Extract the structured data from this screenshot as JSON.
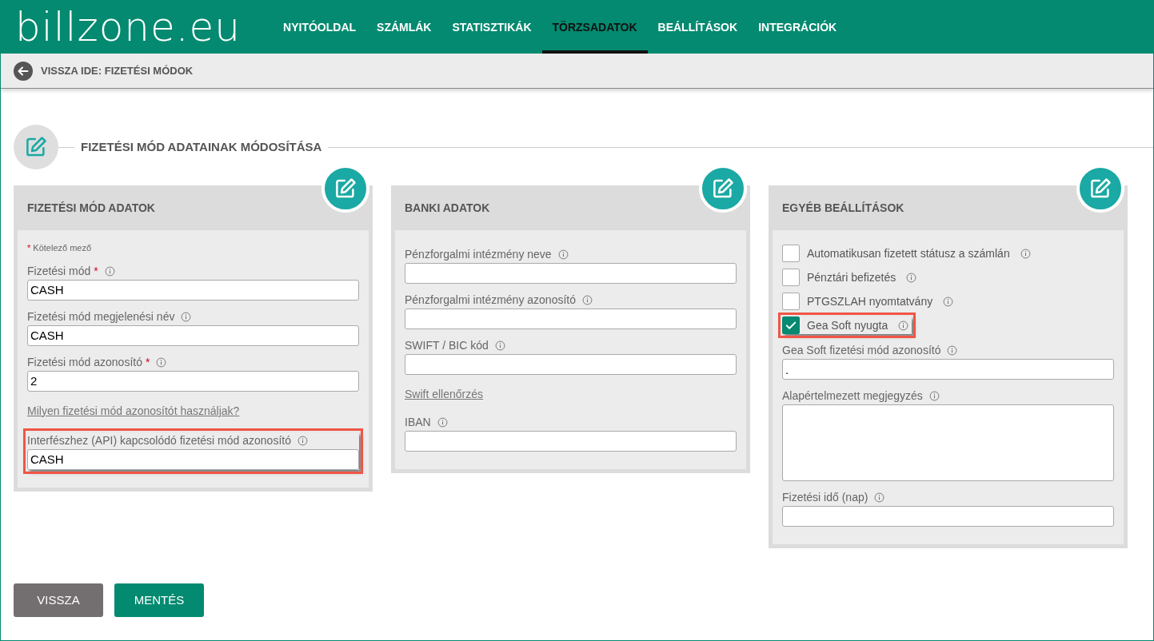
{
  "logo": "billzone.eu",
  "nav": [
    {
      "label": "NYITÓOLDAL",
      "selected": false
    },
    {
      "label": "SZÁMLÁK",
      "selected": false
    },
    {
      "label": "STATISZTIKÁK",
      "selected": false
    },
    {
      "label": "TÖRZSADATOK",
      "selected": true
    },
    {
      "label": "BEÁLLÍTÁSOK",
      "selected": false
    },
    {
      "label": "INTEGRÁCIÓK",
      "selected": false
    }
  ],
  "breadcrumb": "VISSZA IDE: FIZETÉSI MÓDOK",
  "section_title": "FIZETÉSI MÓD ADATAINAK MÓDOSÍTÁSA",
  "cards": [
    {
      "title": "FIZETÉSI MÓD ADATOK",
      "fields": [
        {
          "kind": "note",
          "mark": "*",
          "text": "Kötelező mező"
        },
        {
          "kind": "input",
          "label": "Fizetési mód",
          "required_mark": "*",
          "value": "CASH",
          "highlighted": false
        },
        {
          "kind": "input",
          "label": "Fizetési mód megjelenési név",
          "value": "CASH",
          "highlighted": false
        },
        {
          "kind": "input",
          "label": "Fizetési mód azonosító",
          "required_mark": "*",
          "value": "2",
          "highlighted": false
        },
        {
          "kind": "link",
          "text": "Milyen fizetési mód azonosítót használjak?"
        },
        {
          "kind": "input",
          "label": "Interfészhez (API) kapcsolódó fizetési mód azonosító",
          "value": "CASH",
          "highlighted": true
        }
      ]
    },
    {
      "title": "BANKI ADATOK",
      "fields": [
        {
          "kind": "input",
          "label": "Pénzforgalmi intézmény neve",
          "highlighted": false
        },
        {
          "kind": "input",
          "label": "Pénzforgalmi intézmény azonosító",
          "highlighted": false
        },
        {
          "kind": "input",
          "label": "SWIFT / BIC kód",
          "highlighted": false
        },
        {
          "kind": "link",
          "text": "Swift ellenőrzés"
        },
        {
          "kind": "input",
          "label": "IBAN",
          "highlighted": false
        }
      ]
    },
    {
      "title": "EGYÉB BEÁLLÍTÁSOK",
      "fields": [
        {
          "kind": "checkbox",
          "label": "Automatikusan fizetett státusz a számlán",
          "checked": false,
          "highlighted": false
        },
        {
          "kind": "checkbox",
          "label": "Pénztári befizetés",
          "checked": false,
          "highlighted": false
        },
        {
          "kind": "checkbox",
          "label": "PTGSZLAH nyomtatvány",
          "checked": false,
          "highlighted": false
        },
        {
          "kind": "checkbox",
          "label": "Gea Soft nyugta",
          "checked": true,
          "highlighted": true
        },
        {
          "kind": "input",
          "label": "Gea Soft fizetési mód azonosító",
          "value": ".",
          "highlighted": false
        },
        {
          "kind": "textarea",
          "label": "Alapértelmezett megjegyzés",
          "highlighted": false
        },
        {
          "kind": "input",
          "label": "Fizetési idő (nap)",
          "highlighted": false
        }
      ]
    }
  ],
  "buttons": [
    {
      "label": "VISSZA",
      "kind": "secondary"
    },
    {
      "label": "MENTÉS",
      "kind": "primary"
    }
  ]
}
